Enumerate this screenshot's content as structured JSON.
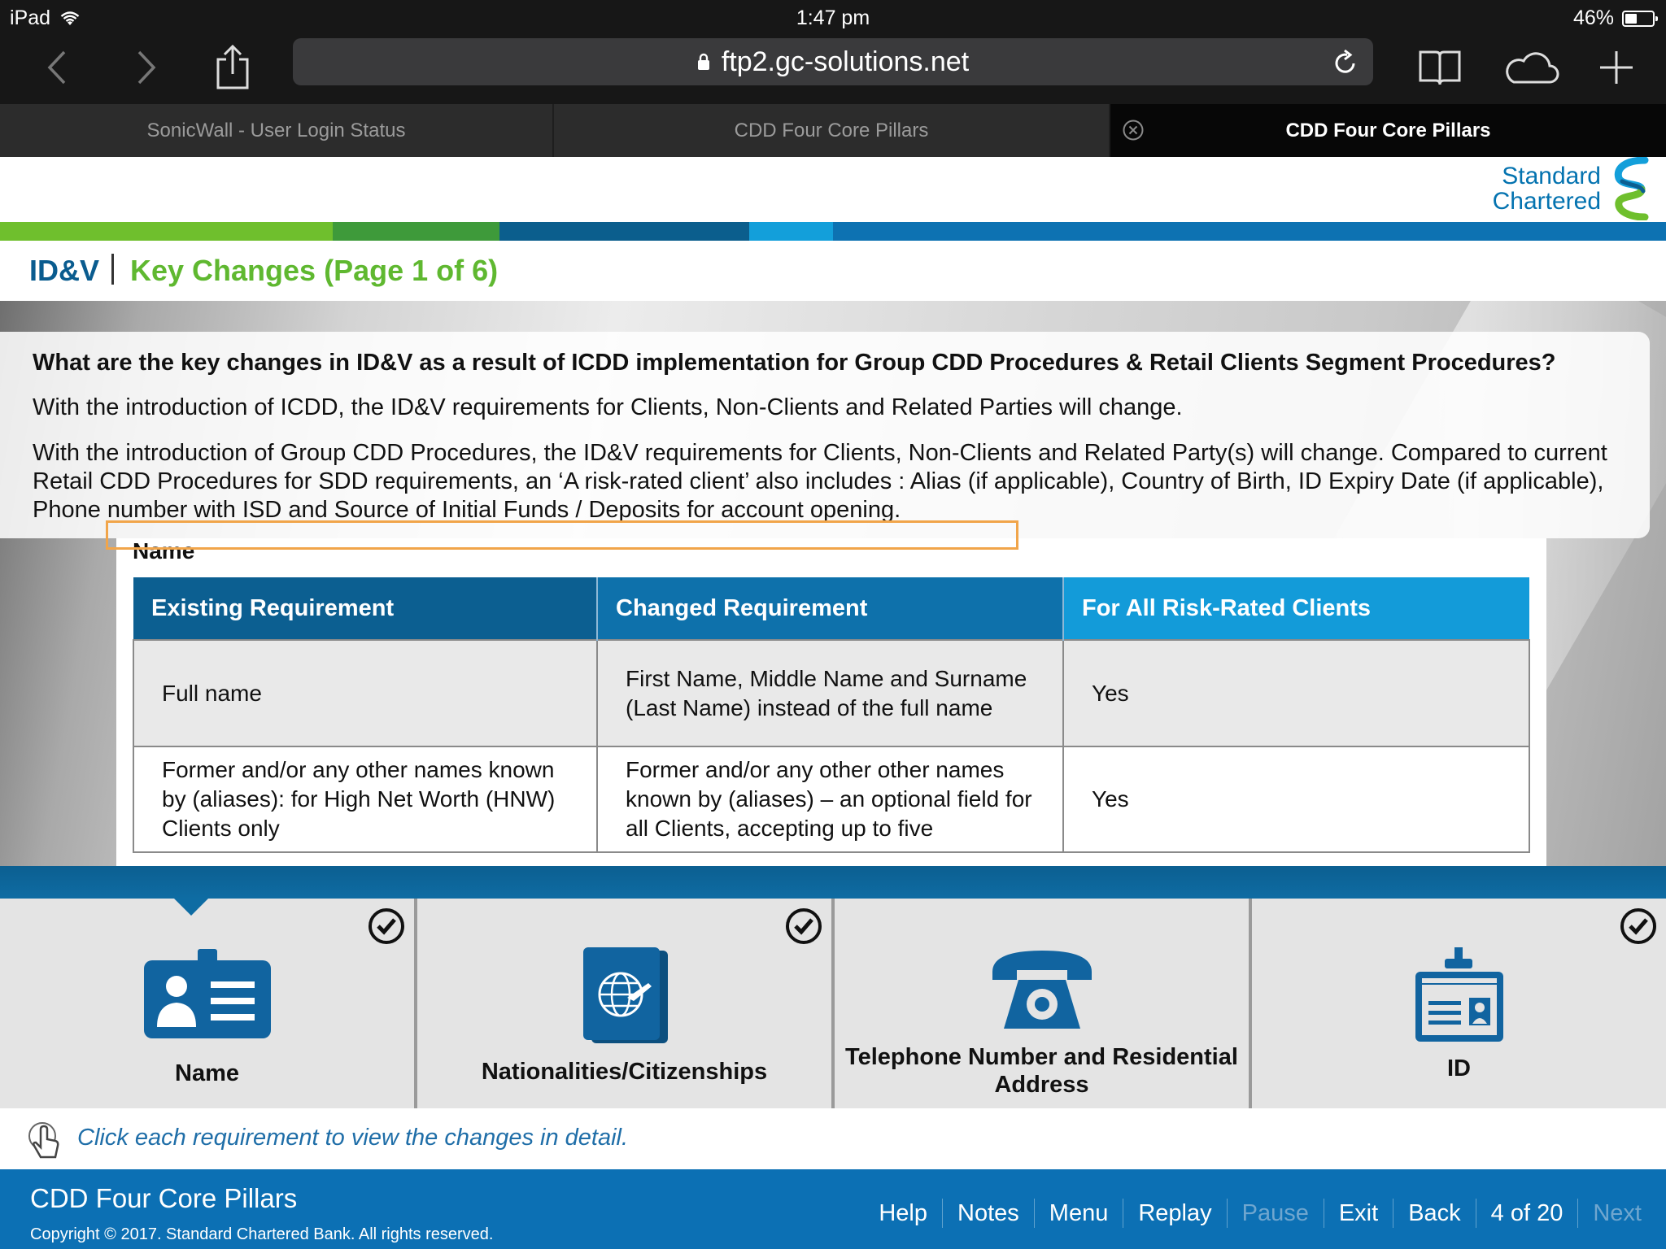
{
  "status_bar": {
    "device": "iPad",
    "time": "1:47 pm",
    "battery": "46%"
  },
  "browser": {
    "url": "ftp2.gc-solutions.net",
    "tabs": [
      {
        "label": "SonicWall - User Login Status"
      },
      {
        "label": "CDD Four Core Pillars"
      },
      {
        "label": "CDD Four Core Pillars"
      }
    ]
  },
  "brand": {
    "line1": "Standard",
    "line2": "Chartered",
    "colors": [
      "#6fbf2d",
      "#3e9a3a",
      "#0b5e8d",
      "#139fda",
      "#0d72b2"
    ]
  },
  "header": {
    "section": "ID&V",
    "page_title": "Key Changes (Page 1 of 6)"
  },
  "intro": {
    "question": "What are the key changes in ID&V as a result of ICDD implementation for Group CDD Procedures & Retail Clients Segment Procedures?",
    "para1": "With the introduction of ICDD, the ID&V requirements for Clients, Non-Clients and Related Parties will change.",
    "para2": "With the introduction of Group CDD Procedures, the ID&V requirements for Clients, Non-Clients and Related Party(s) will change. Compared to current Retail CDD Procedures for SDD requirements, an ‘A risk-rated client’ also includes : Alias (if applicable), Country of Birth, ID Expiry Date (if applicable), Phone number with ISD and Source of Initial Funds / Deposits for account opening."
  },
  "table": {
    "caption": "Name",
    "headers": [
      "Existing Requirement",
      "Changed Requirement",
      "For All Risk-Rated Clients"
    ],
    "rows": [
      [
        "Full name",
        "First Name, Middle Name and Surname (Last Name) instead of the full name",
        "Yes"
      ],
      [
        "Former and/or any other names known by (aliases): for High Net Worth (HNW) Clients only",
        "Former and/or any other other names known by (aliases) – an optional field for all Clients, accepting up to five",
        "Yes"
      ]
    ]
  },
  "tiles": [
    {
      "label": "Name",
      "icon": "id-badge-icon",
      "completed": true
    },
    {
      "label": "Nationalities/Citizenships",
      "icon": "passport-icon",
      "completed": true
    },
    {
      "label": "Telephone Number and Residential Address",
      "icon": "telephone-icon",
      "completed": false
    },
    {
      "label": "ID",
      "icon": "id-card-icon",
      "completed": true
    }
  ],
  "hint": "Click each requirement to view the changes in detail.",
  "footer": {
    "course_title": "CDD Four Core Pillars",
    "copyright": "Copyright © 2017. Standard Chartered Bank. All rights reserved.",
    "nav": {
      "help": "Help",
      "notes": "Notes",
      "menu": "Menu",
      "replay": "Replay",
      "pause": "Pause",
      "exit": "Exit",
      "back": "Back",
      "progress": "4 of 20",
      "next": "Next"
    }
  }
}
